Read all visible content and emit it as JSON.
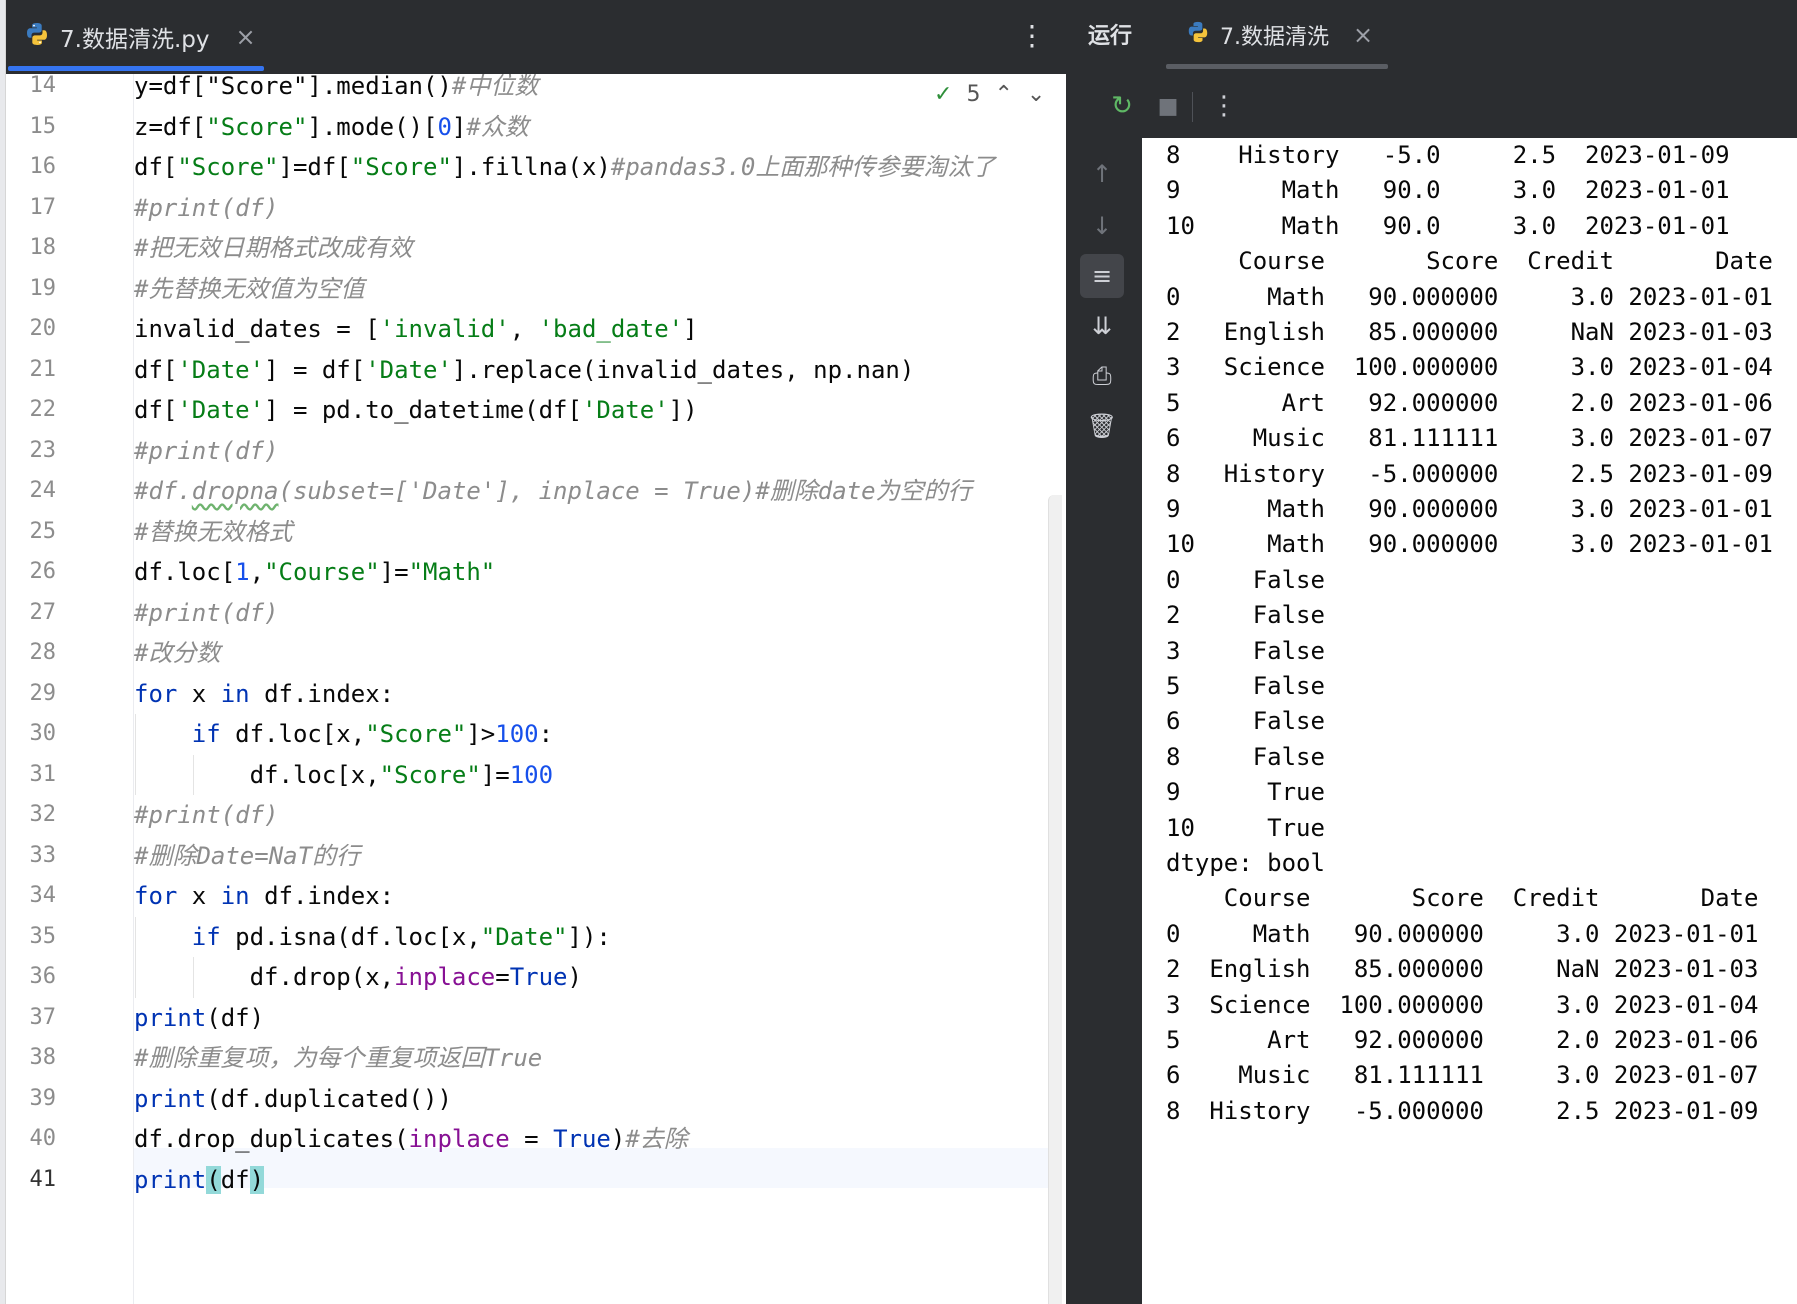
{
  "editor": {
    "tab_label": "7.数据清洗.py",
    "close_glyph": "×",
    "menu_glyph": "⋮",
    "inspection": {
      "check_glyph": "✓",
      "count": "5",
      "up_glyph": "⌃",
      "down_glyph": "⌄"
    },
    "current_line": "41",
    "lines": [
      {
        "num": "14",
        "tokens": [
          [
            "",
            "y=df[\"Score\"].median()"
          ],
          [
            "c",
            "#中位数"
          ]
        ]
      },
      {
        "num": "15",
        "tokens": [
          [
            "",
            "z=df["
          ],
          [
            "s",
            "\"Score\""
          ],
          [
            "",
            "].mode()["
          ],
          [
            "n",
            "0"
          ],
          [
            "",
            "]"
          ],
          [
            "c",
            "#众数"
          ]
        ]
      },
      {
        "num": "16",
        "tokens": [
          [
            "",
            "df["
          ],
          [
            "s",
            "\"Score\""
          ],
          [
            "",
            "]=df["
          ],
          [
            "s",
            "\"Score\""
          ],
          [
            "",
            "].fillna(x)"
          ],
          [
            "c",
            "#pandas3.0上面那种传参要淘汰了"
          ]
        ]
      },
      {
        "num": "17",
        "tokens": [
          [
            "c",
            "#print(df)"
          ]
        ]
      },
      {
        "num": "18",
        "tokens": [
          [
            "c",
            "#把无效日期格式改成有效"
          ]
        ]
      },
      {
        "num": "19",
        "tokens": [
          [
            "c",
            "#先替换无效值为空值"
          ]
        ]
      },
      {
        "num": "20",
        "tokens": [
          [
            "",
            "invalid_dates = ["
          ],
          [
            "s",
            "'invalid'"
          ],
          [
            "",
            ", "
          ],
          [
            "s",
            "'bad_date'"
          ],
          [
            "",
            "]"
          ]
        ]
      },
      {
        "num": "21",
        "tokens": [
          [
            "",
            "df["
          ],
          [
            "s",
            "'Date'"
          ],
          [
            "",
            "] = df["
          ],
          [
            "s",
            "'Date'"
          ],
          [
            "",
            "].replace(invalid_dates, np.nan)"
          ]
        ]
      },
      {
        "num": "22",
        "tokens": [
          [
            "",
            "df["
          ],
          [
            "s",
            "'Date'"
          ],
          [
            "",
            "] = pd.to_datetime(df["
          ],
          [
            "s",
            "'Date'"
          ],
          [
            "",
            "])"
          ]
        ]
      },
      {
        "num": "23",
        "tokens": [
          [
            "c",
            "#print(df)"
          ]
        ]
      },
      {
        "num": "24",
        "tokens": [
          [
            "c",
            "#df."
          ],
          [
            "c squig",
            "dropna"
          ],
          [
            "c",
            "(subset=['Date'], inplace = True)#删除date为空的行"
          ]
        ]
      },
      {
        "num": "25",
        "tokens": [
          [
            "c",
            "#替换无效格式"
          ]
        ]
      },
      {
        "num": "26",
        "tokens": [
          [
            "",
            "df.loc["
          ],
          [
            "n",
            "1"
          ],
          [
            "",
            ","
          ],
          [
            "s",
            "\"Course\""
          ],
          [
            "",
            "]="
          ],
          [
            "s",
            "\"Math\""
          ]
        ]
      },
      {
        "num": "27",
        "tokens": [
          [
            "c",
            "#print(df)"
          ]
        ]
      },
      {
        "num": "28",
        "tokens": [
          [
            "c",
            "#改分数"
          ]
        ]
      },
      {
        "num": "29",
        "tokens": [
          [
            "k",
            "for"
          ],
          [
            "",
            " x "
          ],
          [
            "k",
            "in"
          ],
          [
            "",
            " df.index:"
          ]
        ]
      },
      {
        "num": "30",
        "tokens": [
          [
            "",
            "    "
          ],
          [
            "k",
            "if"
          ],
          [
            "",
            " df.loc[x,"
          ],
          [
            "s",
            "\"Score\""
          ],
          [
            "",
            "]>"
          ],
          [
            "n",
            "100"
          ],
          [
            "",
            ":"
          ]
        ]
      },
      {
        "num": "31",
        "tokens": [
          [
            "",
            "        df.loc[x,"
          ],
          [
            "s",
            "\"Score\""
          ],
          [
            "",
            "]="
          ],
          [
            "n",
            "100"
          ]
        ]
      },
      {
        "num": "32",
        "tokens": [
          [
            "c",
            "#print(df)"
          ]
        ]
      },
      {
        "num": "33",
        "tokens": [
          [
            "c",
            "#删除Date=NaT的行"
          ]
        ]
      },
      {
        "num": "34",
        "tokens": [
          [
            "k",
            "for"
          ],
          [
            "",
            " x "
          ],
          [
            "k",
            "in"
          ],
          [
            "",
            " df.index:"
          ]
        ]
      },
      {
        "num": "35",
        "tokens": [
          [
            "",
            "    "
          ],
          [
            "k",
            "if"
          ],
          [
            "",
            " pd.isna(df.loc[x,"
          ],
          [
            "s",
            "\"Date\""
          ],
          [
            "",
            "]):"
          ]
        ]
      },
      {
        "num": "36",
        "tokens": [
          [
            "",
            "        df.drop(x,"
          ],
          [
            "p",
            "inplace"
          ],
          [
            "",
            "="
          ],
          [
            "k",
            "True"
          ],
          [
            "",
            ")"
          ]
        ]
      },
      {
        "num": "37",
        "tokens": [
          [
            "k",
            "print"
          ],
          [
            "",
            "(df)"
          ]
        ]
      },
      {
        "num": "38",
        "tokens": [
          [
            "c",
            "#删除重复项，为每个重复项返回True"
          ]
        ]
      },
      {
        "num": "39",
        "tokens": [
          [
            "k",
            "print"
          ],
          [
            "",
            "(df.duplicated())"
          ]
        ]
      },
      {
        "num": "40",
        "tokens": [
          [
            "",
            "df.drop_duplicates("
          ],
          [
            "p",
            "inplace"
          ],
          [
            "",
            " = "
          ],
          [
            "k",
            "True"
          ],
          [
            "",
            ")"
          ],
          [
            "c",
            "#去除"
          ]
        ]
      },
      {
        "num": "41",
        "tokens": [
          [
            "k",
            "print"
          ],
          [
            "hl",
            "("
          ],
          [
            "",
            "df"
          ],
          [
            "hl",
            ")"
          ]
        ]
      }
    ]
  },
  "run": {
    "title": "运行",
    "tab_label": "7.数据清洗",
    "close_glyph": "×",
    "toolbar": {
      "rerun_glyph": "↻",
      "stop_glyph": "■",
      "menu_glyph": "⋮"
    },
    "side": {
      "up_glyph": "↑",
      "down_glyph": "↓",
      "wrap_glyph": "≡",
      "scroll_end_glyph": "⇊",
      "print_glyph": "⎙",
      "trash_glyph": "🗑"
    },
    "output": [
      "8    History   -5.0     2.5  2023-01-09",
      "9       Math   90.0     3.0  2023-01-01",
      "10      Math   90.0     3.0  2023-01-01",
      "     Course       Score  Credit       Date",
      "0      Math   90.000000     3.0 2023-01-01",
      "2   English   85.000000     NaN 2023-01-03",
      "3   Science  100.000000     3.0 2023-01-04",
      "5       Art   92.000000     2.0 2023-01-06",
      "6     Music   81.111111     3.0 2023-01-07",
      "8   History   -5.000000     2.5 2023-01-09",
      "9      Math   90.000000     3.0 2023-01-01",
      "10     Math   90.000000     3.0 2023-01-01",
      "0     False",
      "2     False",
      "3     False",
      "5     False",
      "6     False",
      "8     False",
      "9      True",
      "10     True",
      "dtype: bool",
      "    Course       Score  Credit       Date",
      "0     Math   90.000000     3.0 2023-01-01",
      "2  English   85.000000     NaN 2023-01-03",
      "3  Science  100.000000     3.0 2023-01-04",
      "5      Art   92.000000     2.0 2023-01-06",
      "6    Music   81.111111     3.0 2023-01-07",
      "8  History   -5.000000     2.5 2023-01-09"
    ]
  }
}
